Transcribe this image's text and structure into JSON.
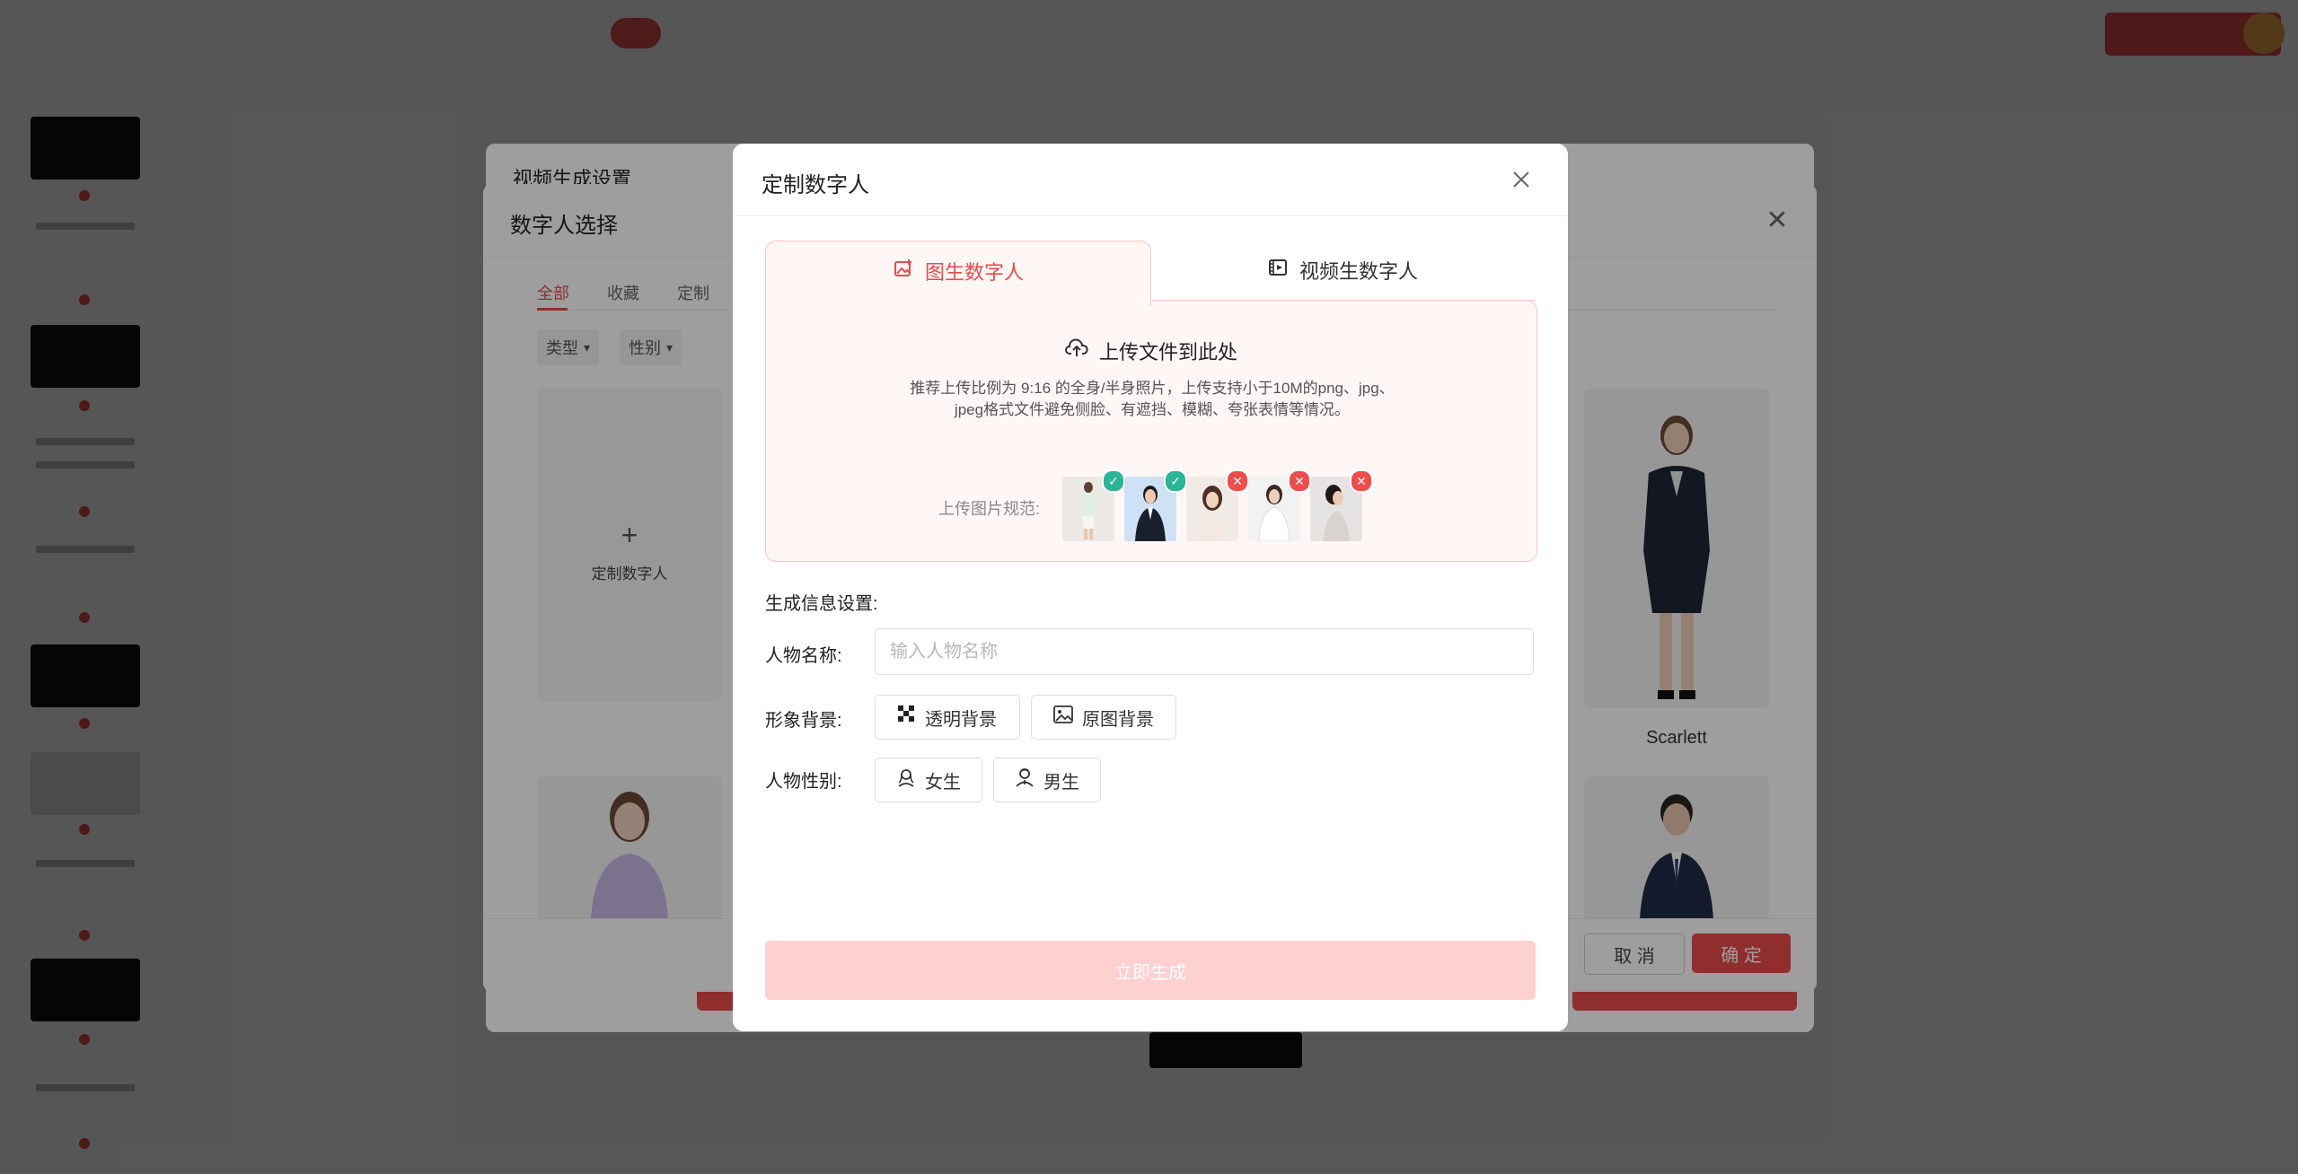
{
  "modal": {
    "title": "定制数字人",
    "tabs": [
      {
        "label": "图生数字人",
        "active": true,
        "icon": "image-add-icon"
      },
      {
        "label": "视频生数字人",
        "active": false,
        "icon": "video-icon"
      }
    ],
    "upload": {
      "heading": "上传文件到此处",
      "desc_line1": "推荐上传比例为 9:16 的全身/半身照片，上传支持小于10M的png、jpg、",
      "desc_line2": "jpeg格式文件避免侧脸、有遮挡、模糊、夸张表情等情况。",
      "spec_label": "上传图片规范:",
      "specs": [
        {
          "name": "full-body",
          "ok": true
        },
        {
          "name": "half-body",
          "ok": true
        },
        {
          "name": "pose",
          "ok": false
        },
        {
          "name": "occluded",
          "ok": false
        },
        {
          "name": "side-face",
          "ok": false
        }
      ]
    },
    "settings": {
      "section_title": "生成信息设置:",
      "name_label": "人物名称:",
      "name_placeholder": "输入人物名称",
      "name_value": "",
      "bg_label": "形象背景:",
      "bg_options": [
        "透明背景",
        "原图背景"
      ],
      "gender_label": "人物性别:",
      "gender_options": [
        "女生",
        "男生"
      ]
    },
    "generate_label": "立即生成"
  },
  "select_modal": {
    "title": "数字人选择",
    "tabs": [
      "全部",
      "收藏",
      "定制"
    ],
    "active_tab": "全部",
    "filters": [
      "类型",
      "性别"
    ],
    "add_card_label": "定制数字人",
    "card_name": "Scarlett",
    "cancel_label": "取 消",
    "ok_label": "确 定"
  },
  "back_modal": {
    "title": "视频生成设置"
  },
  "colors": {
    "accent": "#e94b4b",
    "accent_light": "#ffd0d0",
    "upload_bg": "#fff7f6",
    "ok_badge": "#2bb597",
    "no_badge": "#ef4c4c"
  }
}
